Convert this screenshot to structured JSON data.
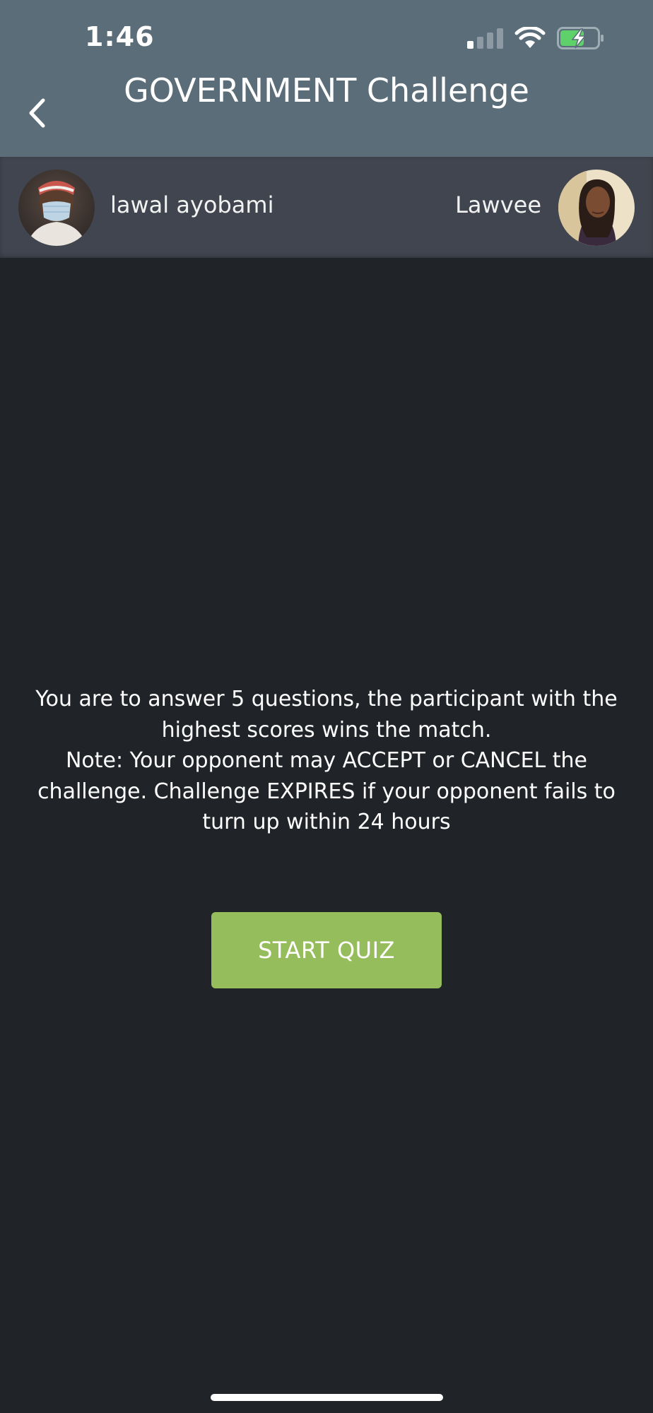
{
  "status_bar": {
    "time": "1:46",
    "icons": [
      "cellular-signal-icon",
      "wifi-icon",
      "battery-charging-icon"
    ]
  },
  "nav": {
    "back_icon": "chevron-left-icon",
    "title": "GOVERNMENT Challenge"
  },
  "players": {
    "left": {
      "name": "lawal ayobami"
    },
    "right": {
      "name": "Lawvee"
    }
  },
  "instructions": {
    "line1": "You are to answer 5 questions, the participant with the highest scores wins the match.",
    "line2": "Note: Your opponent may ACCEPT or CANCEL the challenge. Challenge EXPIRES if your opponent fails to turn up within 24 hours"
  },
  "start_button": {
    "label": "START QUIZ"
  },
  "colors": {
    "header_bg": "#5a6d79",
    "players_bar_bg": "#41454f",
    "page_bg": "#202328",
    "button_bg": "#96bd5c",
    "battery_green": "#5fd16a"
  }
}
